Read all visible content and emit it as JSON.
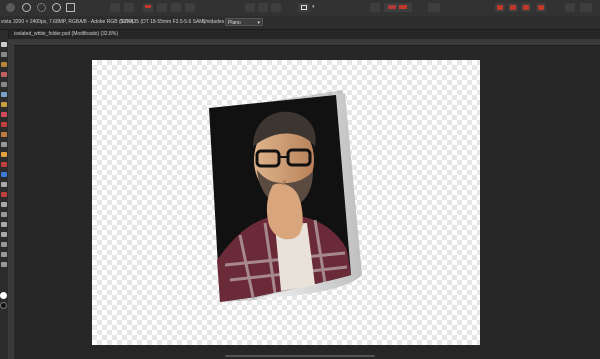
{
  "context_bar": {
    "label_left": "vista",
    "doc_info": "3200 × 2400px, 7.68MP, RGBA/8 - Adobe RGB (1998)",
    "camera": "SLT-A35 (DT 18-55mm F3.5-5.6 SAM)",
    "unit_label": "Unidades",
    "unit_value": "Plano",
    "icon_names": [
      "gear-icon",
      "sparkle-icon",
      "circle-icon",
      "grid-icon"
    ]
  },
  "document_tab": {
    "title": "isolated_white_folder.psd (Modificado) (32.8%)"
  },
  "colors": {
    "accent_red": "#c0392b",
    "ui_dark": "#2b2b2b",
    "canvas": "#262626"
  },
  "photo": {
    "subject": "portrait of bearded man with glasses on curled paper sheet"
  }
}
